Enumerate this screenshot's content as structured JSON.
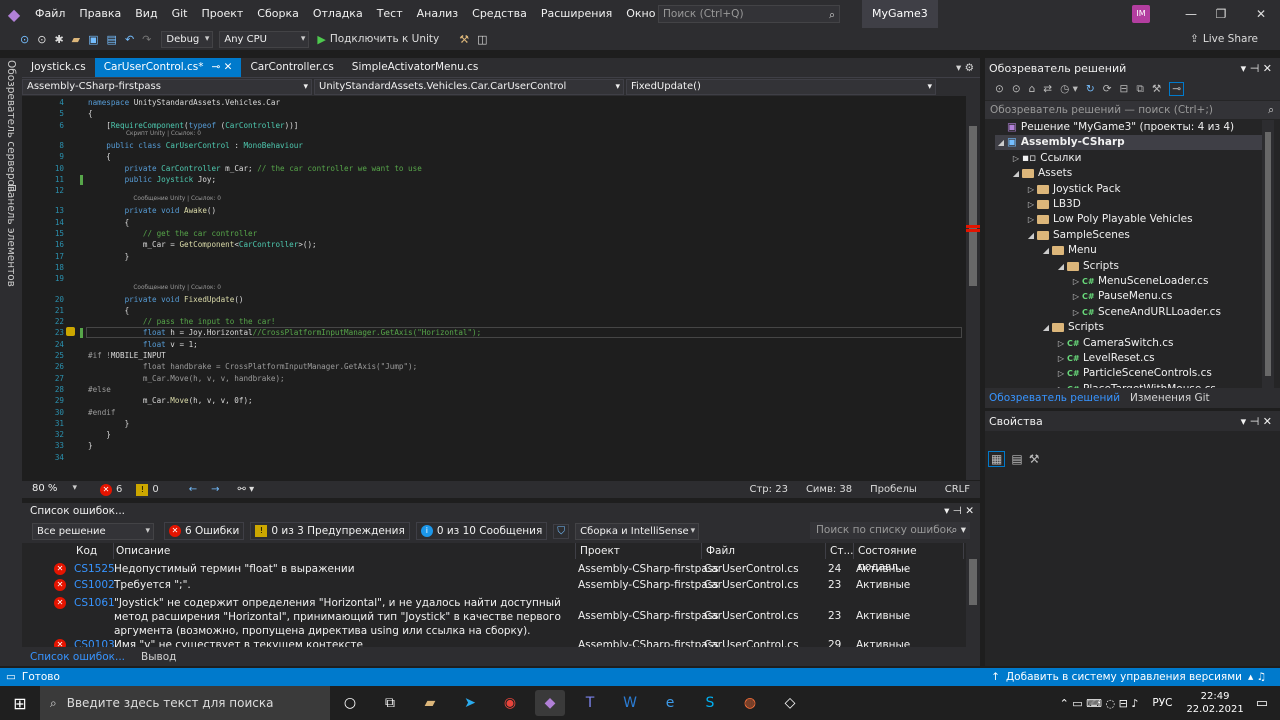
{
  "menubar": {
    "items": [
      "Файл",
      "Правка",
      "Вид",
      "Git",
      "Проект",
      "Сборка",
      "Отладка",
      "Тест",
      "Анализ",
      "Средства",
      "Расширения",
      "Окно",
      "Справка"
    ],
    "search_placeholder": "Поиск (Ctrl+Q)",
    "window_title": "MyGame3",
    "avatar": "IM"
  },
  "toolbar": {
    "config": "Debug",
    "platform": "Any CPU",
    "attach_label": "Подключить к Unity",
    "live_share": "Live Share"
  },
  "left_rail": {
    "server_explorer": "Обозреватель серверов",
    "toolbox": "Панель элементов"
  },
  "tabs": [
    {
      "label": "Joystick.cs",
      "active": false
    },
    {
      "label": "CarUserControl.cs*",
      "active": true
    },
    {
      "label": "CarController.cs",
      "active": false
    },
    {
      "label": "SimpleActivatorMenu.cs",
      "active": false
    }
  ],
  "navbar": {
    "project": "Assembly-CSharp-firstpass",
    "type": "UnityStandardAssets.Vehicles.Car.CarUserControl",
    "member": "FixedUpdate()"
  },
  "editor": {
    "lines": [
      {
        "n": "4",
        "code": "<span class=\"kw\">namespace</span> UnityStandardAssets.Vehicles.Car"
      },
      {
        "n": "5",
        "code": "{"
      },
      {
        "n": "6",
        "code": "    [<span class=\"ty\">RequireComponent</span>(<span class=\"kw\">typeof</span> (<span class=\"ty\">CarController</span>))]"
      },
      {
        "n": "",
        "hint": "Скрипт Unity | Ссылок: 0"
      },
      {
        "n": "8",
        "code": "    <span class=\"kw\">public class</span> <span class=\"ty\">CarUserControl</span> : <span class=\"ty\">MonoBehaviour</span>"
      },
      {
        "n": "9",
        "code": "    {"
      },
      {
        "n": "10",
        "code": "        <span class=\"kw\">private</span> <span class=\"ty\">CarController</span> m_Car; <span class=\"cm\">// the car controller we want to use</span>"
      },
      {
        "n": "11",
        "code": "        <span class=\"kw\">public</span> <span class=\"ty\">Joystick</span> Joy;"
      },
      {
        "n": "12",
        "code": ""
      },
      {
        "n": "",
        "hint": "    Сообщение Unity | Ссылок: 0"
      },
      {
        "n": "13",
        "code": "        <span class=\"kw\">private void</span> <span class=\"fn\">Awake</span>()"
      },
      {
        "n": "14",
        "code": "        {"
      },
      {
        "n": "15",
        "code": "            <span class=\"cm\">// get the car controller</span>"
      },
      {
        "n": "16",
        "code": "            m_Car = <span class=\"fn\">GetComponent</span>&lt;<span class=\"ty\">CarController</span>&gt;();"
      },
      {
        "n": "17",
        "code": "        }"
      },
      {
        "n": "18",
        "code": ""
      },
      {
        "n": "19",
        "code": ""
      },
      {
        "n": "",
        "hint": "    Сообщение Unity | Ссылок: 0"
      },
      {
        "n": "20",
        "code": "        <span class=\"kw\">private void</span> <span class=\"fn\">FixedUpdate</span>()"
      },
      {
        "n": "21",
        "code": "        {"
      },
      {
        "n": "22",
        "code": "            <span class=\"cm\">// pass the input to the car!</span>"
      },
      {
        "n": "23",
        "code": "            <span class=\"kw\">float</span> h = Joy.Horizontal<span class=\"cm\">//CrossPlatformInputManager.GetAxis(\"Horizontal\");</span>"
      },
      {
        "n": "24",
        "code": "            <span class=\"kw\">float</span> v = 1;"
      },
      {
        "n": "25",
        "code": "<span class=\"pp\">#if !</span>MOBILE_INPUT"
      },
      {
        "n": "26",
        "code": "            <span class=\"pp\">float handbrake = CrossPlatformInputManager.GetAxis(\"Jump\");</span>"
      },
      {
        "n": "27",
        "code": "            <span class=\"pp\">m_Car.Move(h, v, v, handbrake);</span>"
      },
      {
        "n": "28",
        "code": "<span class=\"pp\">#else</span>"
      },
      {
        "n": "29",
        "code": "            m_Car.<span class=\"fn\">Move</span>(h, v, v, 0f);"
      },
      {
        "n": "30",
        "code": "<span class=\"pp\">#endif</span>"
      },
      {
        "n": "31",
        "code": "        }"
      },
      {
        "n": "32",
        "code": "    }"
      },
      {
        "n": "33",
        "code": "}"
      },
      {
        "n": "34",
        "code": ""
      }
    ]
  },
  "edit_status": {
    "zoom": "80 %",
    "errors": "6",
    "warnings": "0",
    "line": "Стр: 23",
    "col": "Симв: 38",
    "spaces": "Пробелы",
    "eol": "CRLF"
  },
  "errors": {
    "title": "Список ошибок...",
    "scope": "Все решение",
    "err_filter": "6 Ошибки",
    "warn_filter": "0 из 3 Предупреждения",
    "msg_filter": "0 из 10 Сообщения",
    "build_filter": "Сборка и IntelliSense",
    "search_placeholder": "Поиск по списку ошибок",
    "columns": [
      "Код",
      "Описание",
      "Проект",
      "Файл",
      "Ст...",
      "Состояние подавл..."
    ],
    "rows": [
      {
        "code": "CS1525",
        "desc": "Недопустимый термин \"float\" в выражении",
        "project": "Assembly-CSharp-firstpass",
        "file": "CarUserControl.cs",
        "line": "24",
        "state": "Активные"
      },
      {
        "code": "CS1002",
        "desc": "Требуется \";\".",
        "project": "Assembly-CSharp-firstpass",
        "file": "CarUserControl.cs",
        "line": "23",
        "state": "Активные"
      },
      {
        "code": "CS1061",
        "desc": "\"Joystick\" не содержит определения \"Horizontal\", и не удалось найти доступный метод расширения \"Horizontal\", принимающий тип \"Joystick\" в качестве первого аргумента (возможно, пропущена директива using или ссылка на сборку).",
        "project": "Assembly-CSharp-firstpass",
        "file": "CarUserControl.cs",
        "line": "23",
        "state": "Активные"
      },
      {
        "code": "CS0103",
        "desc": "Имя \"v\" не существует в текущем контексте",
        "project": "Assembly-CSharp-firstpass",
        "file": "CarUserControl.cs",
        "line": "29",
        "state": "Активные"
      }
    ],
    "bottom_tabs": [
      "Список ошибок...",
      "Вывод"
    ]
  },
  "solution": {
    "title": "Обозреватель решений",
    "search_placeholder": "Обозреватель решений — поиск (Ctrl+;)",
    "tree": [
      {
        "label": "Решение \"MyGame3\" (проекты: 4 из 4)",
        "depth": 0,
        "kind": "solution",
        "arrow": ""
      },
      {
        "label": "Assembly-CSharp",
        "depth": 0,
        "kind": "project",
        "arrow": "◢",
        "bold": true
      },
      {
        "label": "Ссылки",
        "depth": 1,
        "kind": "refs",
        "arrow": "▷"
      },
      {
        "label": "Assets",
        "depth": 1,
        "kind": "folder",
        "arrow": "◢"
      },
      {
        "label": "Joystick Pack",
        "depth": 2,
        "kind": "folder",
        "arrow": "▷"
      },
      {
        "label": "LB3D",
        "depth": 2,
        "kind": "folder",
        "arrow": "▷"
      },
      {
        "label": "Low Poly Playable Vehicles",
        "depth": 2,
        "kind": "folder",
        "arrow": "▷"
      },
      {
        "label": "SampleScenes",
        "depth": 2,
        "kind": "folder",
        "arrow": "◢"
      },
      {
        "label": "Menu",
        "depth": 3,
        "kind": "folder",
        "arrow": "◢"
      },
      {
        "label": "Scripts",
        "depth": 4,
        "kind": "folder",
        "arrow": "◢"
      },
      {
        "label": "MenuSceneLoader.cs",
        "depth": 5,
        "kind": "cs",
        "arrow": "▷"
      },
      {
        "label": "PauseMenu.cs",
        "depth": 5,
        "kind": "cs",
        "arrow": "▷"
      },
      {
        "label": "SceneAndURLLoader.cs",
        "depth": 5,
        "kind": "cs",
        "arrow": "▷"
      },
      {
        "label": "Scripts",
        "depth": 3,
        "kind": "folder",
        "arrow": "◢"
      },
      {
        "label": "CameraSwitch.cs",
        "depth": 4,
        "kind": "cs",
        "arrow": "▷"
      },
      {
        "label": "LevelReset.cs",
        "depth": 4,
        "kind": "cs",
        "arrow": "▷"
      },
      {
        "label": "ParticleSceneControls.cs",
        "depth": 4,
        "kind": "cs",
        "arrow": "▷"
      },
      {
        "label": "PlaceTargetWithMouse.cs",
        "depth": 4,
        "kind": "cs",
        "arrow": "▷"
      }
    ],
    "tabs": [
      "Обозреватель решений",
      "Изменения Git"
    ]
  },
  "properties": {
    "title": "Свойства"
  },
  "status": {
    "ready": "Готово",
    "vcs": "Добавить в систему управления версиями"
  },
  "taskbar": {
    "search_placeholder": "Введите здесь текст для поиска",
    "lang": "РУС",
    "time": "22:49",
    "date": "22.02.2021"
  }
}
